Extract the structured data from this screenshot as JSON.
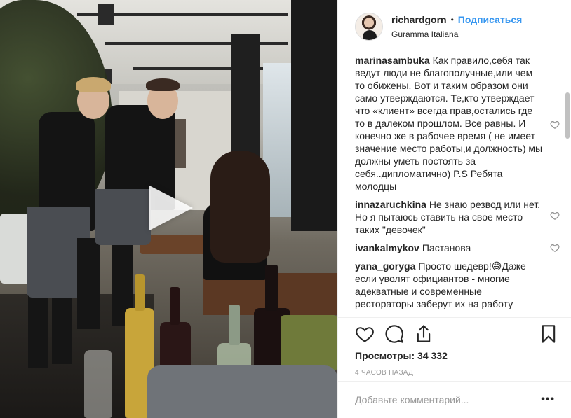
{
  "post": {
    "play_icon": "play-icon",
    "header": {
      "username": "richardgorn",
      "separator": "•",
      "follow_label": "Подписаться",
      "location": "Guramma Italiana"
    },
    "comments": [
      {
        "user": "marinasambuka",
        "text": "Как правило,себя так ведут люди не благополучные,или чем то обижены. Вот и таким образом они само утверждаются. Те,кто утверждает что «клиент» всегда прав,остались где то в далеком прошлом. Все равны. И конечно же в рабочее время ( не имеет значение место работы,и должность) мы должны уметь постоять за себя..дипломатично) P.S Ребята молодцы"
      },
      {
        "user": "innazaruchkina",
        "text": "Не знаю резвод или нет. Но я пытаюсь ставить на свое место таких \"девочек\""
      },
      {
        "user": "ivankalmykov",
        "text": "Пастанова"
      },
      {
        "user": "yana_goryga",
        "text": "Просто шедевр!😅Даже если уволят официантов - многие адекватные и современные рестораторы заберут их на работу"
      }
    ],
    "views_text": "Просмотры: 34 332",
    "time_text": "4 часов назад",
    "comment_placeholder": "Добавьте комментарий...",
    "more_label": "•••"
  }
}
